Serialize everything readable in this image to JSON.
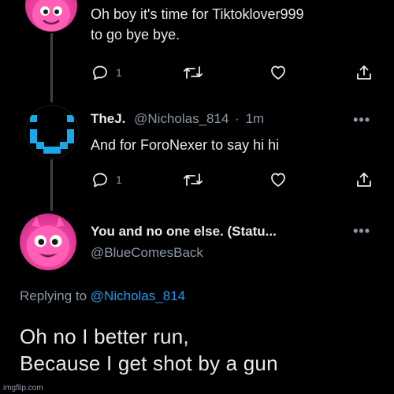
{
  "tweet1": {
    "text_line1": "Oh boy it's time for Tiktoklover999",
    "text_line2": "to go bye bye.",
    "actions": {
      "reply_count": "1",
      "retweet_count": "",
      "like_count": ""
    }
  },
  "tweet2": {
    "name": "TheJ.",
    "handle": "@Nicholas_814",
    "separator": "·",
    "time": "1m",
    "text": "And for ForoNexer to say hi hi",
    "actions": {
      "reply_count": "1",
      "retweet_count": "",
      "like_count": ""
    }
  },
  "tweet3": {
    "name": "You and no one else. (Statu...",
    "handle": "@BlueComesBack",
    "replying_prefix": "Replying to",
    "replying_mention": "@Nicholas_814",
    "text_line1": "Oh no I better run,",
    "text_line2": "Because I get shot by a gun"
  },
  "more_glyph": "•••",
  "watermark": "imgflip.com",
  "colors": {
    "background": "#000000",
    "text": "#e7e9ea",
    "secondary": "#8b98a5",
    "link": "#1d9bf0",
    "avatar_pink": "#e63b9a",
    "avatar_cyan": "#19a8e8"
  },
  "icons": [
    "reply-icon",
    "retweet-icon",
    "like-icon",
    "share-icon",
    "more-icon"
  ]
}
